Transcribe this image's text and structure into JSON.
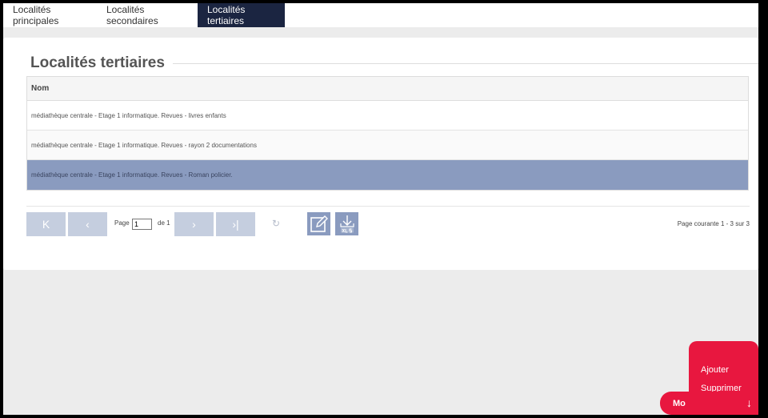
{
  "tabs": [
    {
      "label": "Localités principales"
    },
    {
      "label": "Localités secondaires"
    },
    {
      "label": "Localités tertiaires"
    }
  ],
  "panel": {
    "title": "Localités tertiaires"
  },
  "grid": {
    "header": "Nom",
    "rows": [
      "médiathèque centrale - Etage 1 informatique. Revues - livres enfants",
      "médiathèque centrale - Etage 1 informatique. Revues - rayon 2 documentations",
      "médiathèque centrale - Etage 1 informatique. Revues - Roman policier."
    ],
    "selected_row": 2
  },
  "pager": {
    "first": "K",
    "prev": "‹",
    "page_label": "Page",
    "page_value": "1",
    "of_label": "de 1",
    "next": "›",
    "last": "›|",
    "refresh": "↻",
    "info": "Page courante 1 - 3 sur 3"
  },
  "fab": {
    "menu_items": [
      "Ajouter",
      "Supprimer"
    ],
    "button_label": "Mo",
    "arrow": "↓"
  },
  "colors": {
    "active_tab": "#1b2541",
    "selected_row": "#8a9bbf",
    "fab": "#e8173f"
  }
}
